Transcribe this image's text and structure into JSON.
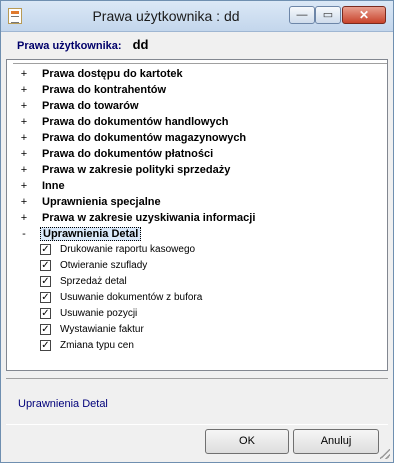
{
  "window": {
    "title": "Prawa użytkownika : dd",
    "min_glyph": "—",
    "max_glyph": "▭",
    "close_glyph": "✕"
  },
  "header": {
    "label": "Prawa użytkownika:",
    "value": "dd"
  },
  "tree": {
    "items": [
      {
        "expander": "+",
        "label": "Prawa dostępu do kartotek"
      },
      {
        "expander": "+",
        "label": "Prawa do kontrahentów"
      },
      {
        "expander": "+",
        "label": "Prawa do towarów"
      },
      {
        "expander": "+",
        "label": "Prawa do dokumentów handlowych"
      },
      {
        "expander": "+",
        "label": "Prawa do dokumentów magazynowych"
      },
      {
        "expander": "+",
        "label": "Prawa do dokumentów płatności"
      },
      {
        "expander": "+",
        "label": "Prawa w zakresie polityki sprzedaży"
      },
      {
        "expander": "+",
        "label": "Inne"
      },
      {
        "expander": "+",
        "label": "Uprawnienia specjalne"
      },
      {
        "expander": "+",
        "label": "Prawa w zakresie uzyskiwania informacji"
      },
      {
        "expander": "-",
        "label": "Uprawnienia Detal"
      }
    ],
    "checks": [
      {
        "checked": true,
        "label": "Drukowanie raportu kasowego"
      },
      {
        "checked": true,
        "label": "Otwieranie szuflady"
      },
      {
        "checked": true,
        "label": "Sprzedaż detal"
      },
      {
        "checked": true,
        "label": "Usuwanie dokumentów z bufora"
      },
      {
        "checked": true,
        "label": "Usuwanie pozycji"
      },
      {
        "checked": true,
        "label": "Wystawianie faktur"
      },
      {
        "checked": true,
        "label": "Zmiana typu cen"
      }
    ],
    "check_glyph": "✓"
  },
  "description": "Uprawnienia Detal",
  "buttons": {
    "ok": "OK",
    "cancel": "Anuluj"
  }
}
